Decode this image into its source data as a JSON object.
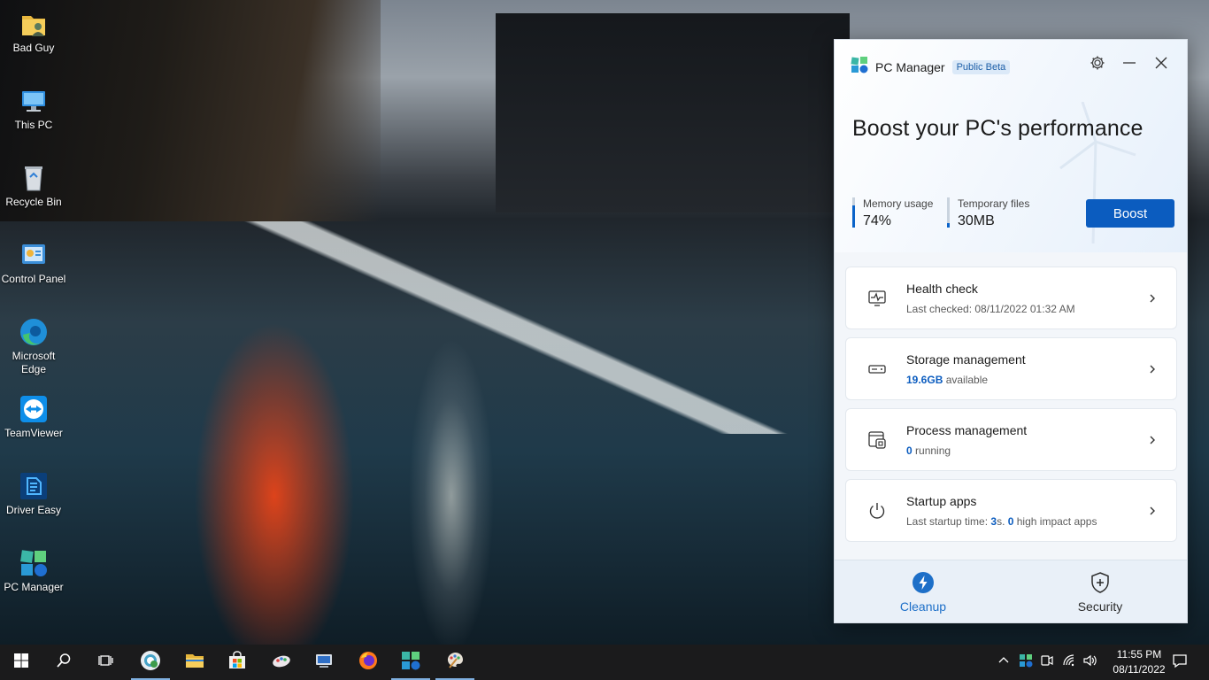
{
  "desktop": {
    "icons": [
      {
        "label": "Bad Guy",
        "icon": "user-folder-icon"
      },
      {
        "label": "This PC",
        "icon": "computer-icon"
      },
      {
        "label": "Recycle Bin",
        "icon": "recycle-bin-icon"
      },
      {
        "label": "Control Panel",
        "icon": "control-panel-icon"
      },
      {
        "label": "Microsoft Edge",
        "icon": "edge-icon"
      },
      {
        "label": "TeamViewer",
        "icon": "teamviewer-icon"
      },
      {
        "label": "Driver Easy",
        "icon": "driver-easy-icon"
      },
      {
        "label": "PC Manager",
        "icon": "pc-manager-icon"
      }
    ]
  },
  "pc_manager": {
    "title": "PC Manager",
    "badge": "Public Beta",
    "headline": "Boost your PC's performance",
    "stats": {
      "memory_label": "Memory usage",
      "memory_value": "74%",
      "memory_fraction": 0.74,
      "temp_label": "Temporary files",
      "temp_value": "30MB",
      "temp_fraction": 0.15
    },
    "boost_label": "Boost",
    "cards": {
      "health": {
        "title": "Health check",
        "subtitle": "Last checked: 08/11/2022 01:32 AM"
      },
      "storage": {
        "title": "Storage management",
        "value": "19.6GB",
        "suffix": " available"
      },
      "process": {
        "title": "Process management",
        "value": "0",
        "suffix": " running"
      },
      "startup": {
        "title": "Startup apps",
        "prefix": "Last startup time: ",
        "time_value": "3",
        "mid": "s. ",
        "impact_value": "0",
        "suffix": " high impact apps"
      }
    },
    "nav": {
      "cleanup": "Cleanup",
      "security": "Security"
    },
    "colors": {
      "accent": "#0b5cbf",
      "nav_active": "#1d6fc8",
      "nav_inactive": "#2b2b2b"
    }
  },
  "taskbar": {
    "time": "11:55 PM",
    "date": "08/11/2022"
  }
}
